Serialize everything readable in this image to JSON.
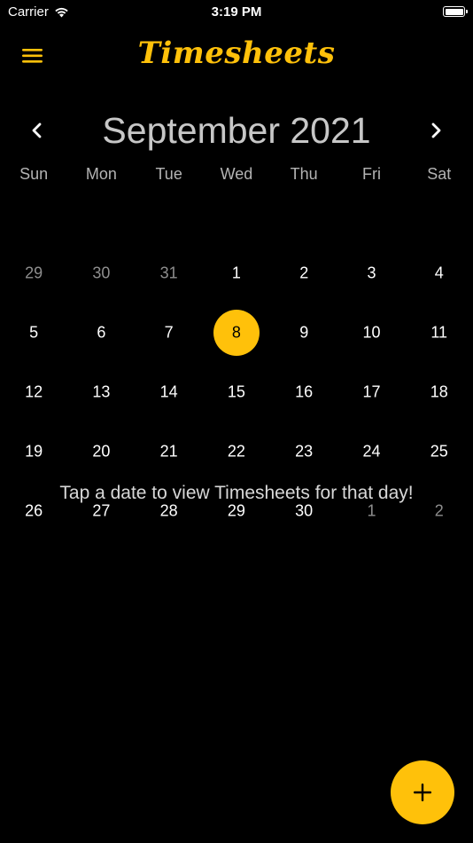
{
  "status_bar": {
    "carrier": "Carrier",
    "time": "3:19 PM"
  },
  "header": {
    "title": "Timesheets",
    "menu_icon": "hamburger-menu-icon",
    "accent_color": "#ffc10a"
  },
  "calendar": {
    "month_title": "September 2021",
    "prev_icon": "chevron-left-icon",
    "next_icon": "chevron-right-icon",
    "weekdays": [
      "Sun",
      "Mon",
      "Tue",
      "Wed",
      "Thu",
      "Fri",
      "Sat"
    ],
    "weeks": [
      [
        "29",
        "30",
        "31",
        "1",
        "2",
        "3",
        "4"
      ],
      [
        "5",
        "6",
        "7",
        "8",
        "9",
        "10",
        "11"
      ],
      [
        "12",
        "13",
        "14",
        "15",
        "16",
        "17",
        "18"
      ],
      [
        "19",
        "20",
        "21",
        "22",
        "23",
        "24",
        "25"
      ],
      [
        "26",
        "27",
        "28",
        "29",
        "30",
        "1",
        "2"
      ]
    ],
    "selected_day": "8"
  },
  "hint_text": "Tap a date to view Timesheets for that day!",
  "fab": {
    "icon": "plus-icon"
  }
}
